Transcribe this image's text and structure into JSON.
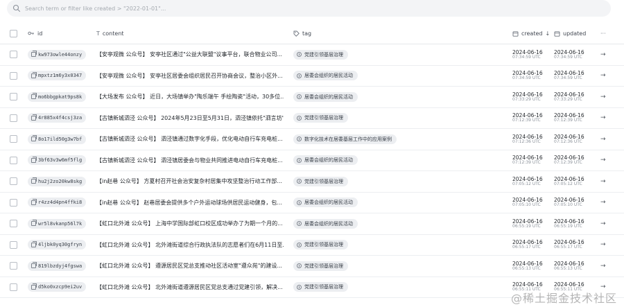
{
  "search": {
    "placeholder": "Search term or filter like created > \"2022-01-01\"..."
  },
  "columns": {
    "id": "id",
    "content": "content",
    "tag": "tag",
    "created": "created",
    "created_sort": "↓",
    "updated": "updated",
    "more": "···"
  },
  "rows": [
    {
      "id": "kw973owle44onzy",
      "content": "【安亭观微 公众号】 安亭社区通过\"公益大联盟\"议事平台，联合物业公司...",
      "tag": "党建引领基层治理",
      "created_date": "2024-06-16",
      "created_time": "07:34:59 UTC",
      "updated_date": "2024-06-16",
      "updated_time": "07:34:59 UTC"
    },
    {
      "id": "mpxtz1m6y3x0347",
      "content": "【安亭观微 公众号】 安亭社区居委会组织居民召开协商会议，整治小区外...",
      "tag": "居委会组织的居民活动",
      "created_date": "2024-06-16",
      "created_time": "07:34:59 UTC",
      "updated_date": "2024-06-16",
      "updated_time": "07:34:59 UTC"
    },
    {
      "id": "mo6bbgpkat9ps8k",
      "content": "【大场发布 公众号】 近日，大场镇举办\"陶乐端午 手绘陶瓷\"活动，30多位...",
      "tag": "居委会组织的居民活动",
      "created_date": "2024-06-16",
      "created_time": "07:33:29 UTC",
      "updated_date": "2024-06-16",
      "updated_time": "07:33:29 UTC"
    },
    {
      "id": "4r885x4f4csj3za",
      "content": "【古镇新城泗泾 公众号】 2024年5月23日至5月31日，泗泾镇依托\"泗言坊\"...",
      "tag": "党建引领基层治理",
      "created_date": "2024-06-16",
      "created_time": "07:12:39 UTC",
      "updated_date": "2024-06-16",
      "updated_time": "07:12:39 UTC"
    },
    {
      "id": "8o17ild50g3w7bf",
      "content": "【古镇新城泗泾 公众号】 泗泾镇通过数字化手段，优化电动自行车充电桩...",
      "tag": "数字化技术在居委基层工作中的应用案例",
      "created_date": "2024-06-16",
      "created_time": "07:12:36 UTC",
      "updated_date": "2024-06-16",
      "updated_time": "07:12:36 UTC"
    },
    {
      "id": "3bf63v3w6mf5flg",
      "content": "【古镇新城泗泾 公众号】 泗泾镇居委会与物业共同推进电动自行车充电桩...",
      "tag": "居委会组织的居民活动",
      "created_date": "2024-06-16",
      "created_time": "07:12:39 UTC",
      "updated_date": "2024-06-16",
      "updated_time": "07:12:39 UTC"
    },
    {
      "id": "hu2j2zo20kw8skg",
      "content": "【in赵巷 公众号】 方夏村召开社会治安复杂村居集中攻坚整治行动工作部...",
      "tag": "党建引领基层治理",
      "created_date": "2024-06-16",
      "created_time": "07:05:12 UTC",
      "updated_date": "2024-06-16",
      "updated_time": "07:05:12 UTC"
    },
    {
      "id": "r4zz4d4pn4ffki8",
      "content": "【in赵巷 公众号】 赵巷居委会提供多个户外运动球场供居民运动健身，包...",
      "tag": "居委会组织的居民活动",
      "created_date": "2024-06-16",
      "created_time": "07:05:10 UTC",
      "updated_date": "2024-06-16",
      "updated_time": "07:05:10 UTC"
    },
    {
      "id": "wr5l8vkanp56l7k",
      "content": "【虹口北外滩 公众号】 上海中学国际部虹口校区成功举办了为期一个月的...",
      "tag": "居委会组织的居民活动",
      "created_date": "2024-06-16",
      "created_time": "06:55:19 UTC",
      "updated_date": "2024-06-16",
      "updated_time": "06:55:19 UTC"
    },
    {
      "id": "4ljbk0yq30gfryn",
      "content": "【虹口北外滩 公众号】 北外滩街道综合行政执法队的志愿者们在6月11日至...",
      "tag": "党建引领基层治理",
      "created_date": "2024-06-16",
      "created_time": "06:55:17 UTC",
      "updated_date": "2024-06-16",
      "updated_time": "06:55:17 UTC"
    },
    {
      "id": "819lbzdyj4fgswa",
      "content": "【虹口北外滩 公众号】 遵源居民区党总支推动社区活动室\"遵众苑\"的建设...",
      "tag": "党建引领基层治理",
      "created_date": "2024-06-16",
      "created_time": "06:55:13 UTC",
      "updated_date": "2024-06-16",
      "updated_time": "06:55:13 UTC"
    },
    {
      "id": "d5ko0xzcp9ei2uv",
      "content": "【虹口北外滩 公众号】 北外滩街道遵源居民区党总支通过党建引领，解决...",
      "tag": "党建引领基层治理",
      "created_date": "2024-06-16",
      "created_time": "06:55:11 UTC",
      "updated_date": "2024-06-16",
      "updated_time": "06:55:11 UTC"
    }
  ],
  "watermark": "@稀土掘金技术社区",
  "colors": {
    "search_bg": "#f3f4f6",
    "pill_bg": "#eceef1",
    "row_border": "#eceef1"
  }
}
